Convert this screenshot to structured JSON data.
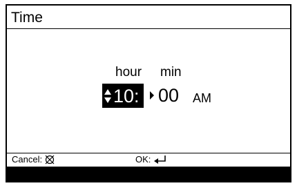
{
  "screen": {
    "title": "Time",
    "labels": {
      "hour": "hour",
      "min": "min"
    },
    "time": {
      "hour": "10:",
      "minute": "00",
      "ampm": "AM"
    },
    "footer": {
      "cancel_label": "Cancel:",
      "cancel_icon": "cancel-x-circle-icon",
      "ok_label": "OK:",
      "ok_icon": "enter-return-icon"
    },
    "icons": {
      "selection_indicator": "up-down-arrows-icon",
      "next_field": "right-triangle-arrow-icon"
    },
    "colors": {
      "background": "#ffffff",
      "foreground": "#000000",
      "highlight": "#000000"
    }
  }
}
